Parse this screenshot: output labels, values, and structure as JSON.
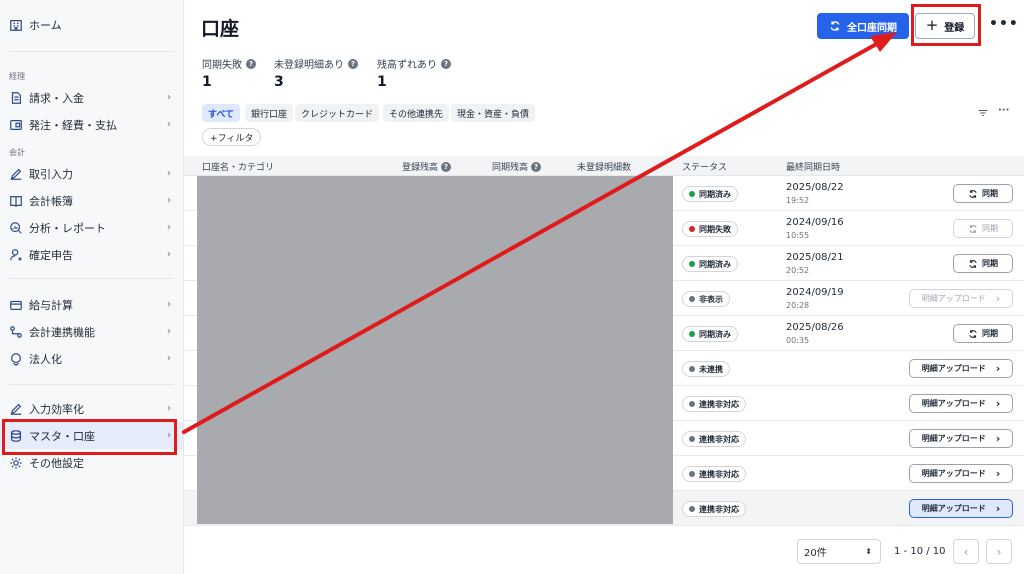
{
  "sidebar": {
    "home": "ホーム",
    "section_keiri": "経理",
    "section_kaikei": "会計",
    "items": [
      {
        "label": "請求・入金"
      },
      {
        "label": "発注・経費・支払"
      },
      {
        "label": "取引入力"
      },
      {
        "label": "会計帳簿"
      },
      {
        "label": "分析・レポート"
      },
      {
        "label": "確定申告"
      },
      {
        "label": "給与計算"
      },
      {
        "label": "会計連携機能"
      },
      {
        "label": "法人化"
      },
      {
        "label": "入力効率化"
      },
      {
        "label": "マスタ・口座"
      },
      {
        "label": "その他設定"
      }
    ],
    "chevron": "›"
  },
  "header": {
    "title": "口座",
    "sync_all_label": "全口座同期",
    "register_label": "登録",
    "more_label": "•••"
  },
  "stats": [
    {
      "label": "同期失敗",
      "value": "1"
    },
    {
      "label": "未登録明細あり",
      "value": "3"
    },
    {
      "label": "残高ずれあり",
      "value": "1"
    }
  ],
  "filters": {
    "chips": [
      "すべて",
      "銀行口座",
      "クレジットカード",
      "その他連携先",
      "現金・資産・負債"
    ],
    "add_filter": "+フィルタ"
  },
  "table": {
    "columns": [
      "口座名・カテゴリ",
      "登録残高",
      "同期残高",
      "未登録明細数",
      "ステータス",
      "最終同期日時"
    ],
    "rows": [
      {
        "status": "同期済み",
        "status_color": "#16a34a",
        "date": "2025/08/22",
        "time": "19:52",
        "action": "同期",
        "action_type": "sync"
      },
      {
        "status": "同期失敗",
        "status_color": "#dc2626",
        "date": "2024/09/16",
        "time": "10:55",
        "action": "同期",
        "action_type": "sync-disabled"
      },
      {
        "status": "同期済み",
        "status_color": "#16a34a",
        "date": "2025/08/21",
        "time": "20:52",
        "action": "同期",
        "action_type": "sync"
      },
      {
        "status": "非表示",
        "status_color": "#6b7280",
        "date": "2024/09/19",
        "time": "20:28",
        "action": "明細アップロード",
        "action_type": "upload-disabled"
      },
      {
        "status": "同期済み",
        "status_color": "#16a34a",
        "date": "2025/08/26",
        "time": "00:35",
        "action": "同期",
        "action_type": "sync"
      },
      {
        "status": "未連携",
        "status_color": "#6b7280",
        "date": "",
        "time": "",
        "action": "明細アップロード",
        "action_type": "upload"
      },
      {
        "status": "連携非対応",
        "status_color": "#6b7280",
        "date": "",
        "time": "",
        "action": "明細アップロード",
        "action_type": "upload"
      },
      {
        "status": "連携非対応",
        "status_color": "#6b7280",
        "date": "",
        "time": "",
        "action": "明細アップロード",
        "action_type": "upload"
      },
      {
        "status": "連携非対応",
        "status_color": "#6b7280",
        "date": "",
        "time": "",
        "action": "明細アップロード",
        "action_type": "upload"
      },
      {
        "status": "連携非対応",
        "status_color": "#6b7280",
        "date": "",
        "time": "",
        "action": "明細アップロード",
        "action_type": "upload-primary"
      }
    ]
  },
  "pagination": {
    "page_size": "20件",
    "range": "1 - 10 / 10",
    "prev": "‹",
    "next": "›"
  },
  "colors": {
    "accent": "#2563eb",
    "annotation": "#e01b1b"
  }
}
